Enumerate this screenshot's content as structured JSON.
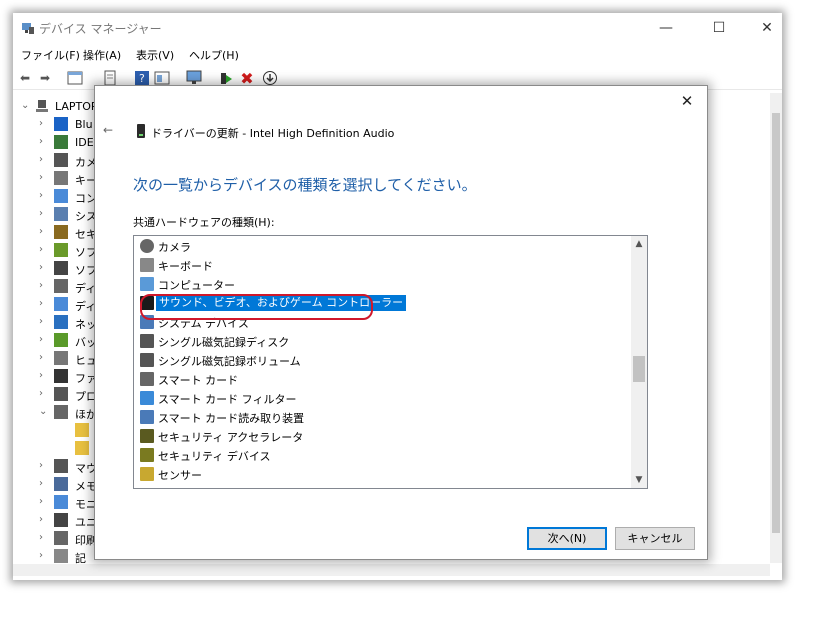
{
  "window": {
    "title": "デバイス マネージャー",
    "controls": {
      "minimize": "—",
      "maximize": "☐",
      "close": "✕"
    }
  },
  "menu": [
    "ファイル(F)",
    "操作(A)",
    "表示(V)",
    "ヘルプ(H)"
  ],
  "toolbar": {
    "icons": [
      "back-arrow-icon",
      "forward-arrow-icon",
      "properties-icon",
      "page-icon",
      "help-icon",
      "view-icon",
      "monitor-icon",
      "enable-driver-icon",
      "uninstall-x-icon",
      "update-download-icon"
    ]
  },
  "tree": {
    "root": "LAPTOP",
    "items": [
      "Blu",
      "IDE",
      "カメ",
      "キー",
      "コン",
      "シス",
      "セキ",
      "ソフ",
      "ソフ",
      "ディ",
      "ディ",
      "ネッ",
      "バッ",
      "ヒュ",
      "ファ",
      "プロ",
      "ほか",
      "",
      "",
      "マウ",
      "メモ",
      "モニ",
      "ユニ",
      "印刷",
      "記"
    ]
  },
  "dialog": {
    "back_label": "←",
    "title": "ドライバーの更新 - Intel High Definition Audio",
    "close": "✕",
    "heading": "次の一覧からデバイスの種類を選択してください。",
    "list_label": "共通ハードウェアの種類(H):",
    "list_items": [
      "カメラ",
      "キーボード",
      "コンピューター",
      "サウンド、ビデオ、およびゲーム コントローラー",
      "システム デバイス",
      "シングル磁気記録ディスク",
      "シングル磁気記録ボリューム",
      "スマート カード",
      "スマート カード フィルター",
      "スマート カード読み取り装置",
      "セキュリティ アクセラレータ",
      "セキュリティ デバイス",
      "センサー"
    ],
    "selected_item": "サウンド、ビデオ、およびゲーム コントローラー",
    "next_button": "次へ(N)",
    "cancel_button": "キャンセル"
  }
}
